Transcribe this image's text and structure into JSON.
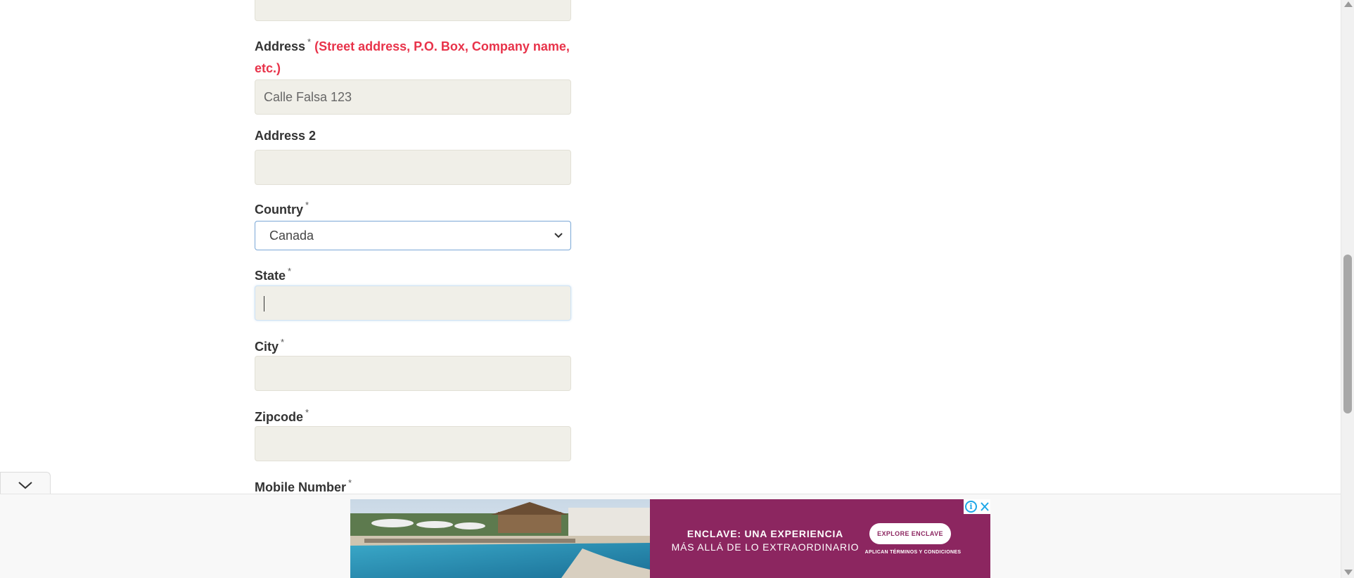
{
  "form": {
    "address": {
      "label": "Address",
      "required_mark": "*",
      "hint_line1": "(Street address, P.O. Box, Company name,",
      "hint_line2": "etc.)",
      "value": "Calle Falsa 123"
    },
    "address2": {
      "label": "Address 2",
      "value": ""
    },
    "country": {
      "label": "Country",
      "required_mark": "*",
      "selected": "Canada"
    },
    "state": {
      "label": "State",
      "required_mark": "*",
      "value": ""
    },
    "city": {
      "label": "City",
      "required_mark": "*",
      "value": ""
    },
    "zipcode": {
      "label": "Zipcode",
      "required_mark": "*",
      "value": ""
    },
    "mobile": {
      "label": "Mobile Number",
      "required_mark": "*"
    }
  },
  "ad": {
    "headline": "ENCLAVE: UNA EXPERIENCIA",
    "subline": "MÁS ALLÁ DE LO EXTRAORDINARIO",
    "cta": "EXPLORE ENCLAVE",
    "terms": "APLICAN TÉRMINOS Y CONDICIONES",
    "info_icon": "i",
    "bg_color": "#8c2660"
  },
  "icons": {
    "collapse": "chevron-down-icon",
    "select": "chevron-down-icon",
    "ad_info": "info-icon",
    "ad_close": "close-icon"
  }
}
